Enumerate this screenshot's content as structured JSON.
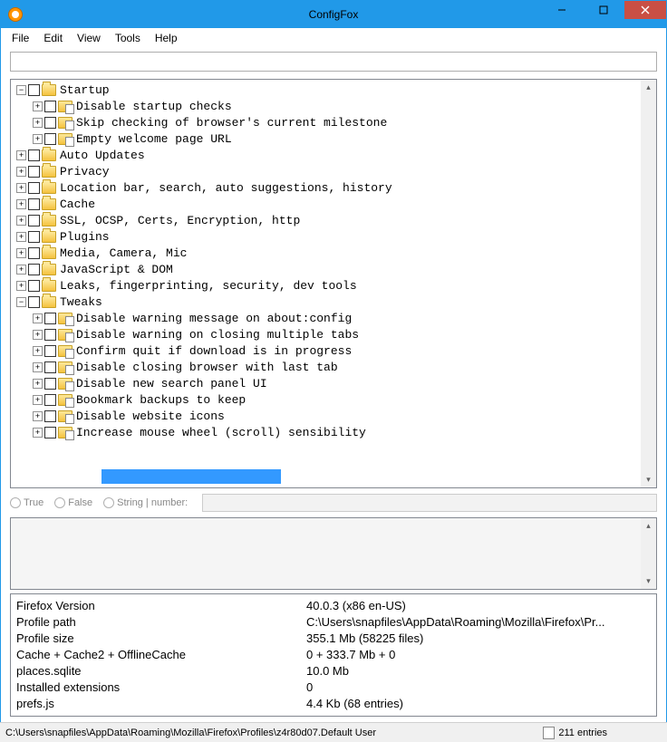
{
  "window": {
    "title": "ConfigFox"
  },
  "menu": [
    "File",
    "Edit",
    "View",
    "Tools",
    "Help"
  ],
  "tree": [
    {
      "indent": 0,
      "exp": "-",
      "check": true,
      "icon": "open",
      "label": "Startup"
    },
    {
      "indent": 1,
      "exp": "+",
      "check": true,
      "icon": "doc",
      "label": "Disable startup checks"
    },
    {
      "indent": 1,
      "exp": "+",
      "check": true,
      "icon": "doc",
      "label": "Skip checking of browser's current milestone"
    },
    {
      "indent": 1,
      "exp": "+",
      "check": true,
      "icon": "doc",
      "label": "Empty welcome page URL"
    },
    {
      "indent": 0,
      "exp": "+",
      "check": true,
      "icon": "open",
      "label": "Auto Updates"
    },
    {
      "indent": 0,
      "exp": "+",
      "check": true,
      "icon": "open",
      "label": "Privacy"
    },
    {
      "indent": 0,
      "exp": "+",
      "check": true,
      "icon": "open",
      "label": "Location bar, search, auto suggestions, history"
    },
    {
      "indent": 0,
      "exp": "+",
      "check": true,
      "icon": "open",
      "label": "Cache"
    },
    {
      "indent": 0,
      "exp": "+",
      "check": true,
      "icon": "open",
      "label": "SSL, OCSP, Certs, Encryption, http"
    },
    {
      "indent": 0,
      "exp": "+",
      "check": true,
      "icon": "open",
      "label": "Plugins"
    },
    {
      "indent": 0,
      "exp": "+",
      "check": true,
      "icon": "open",
      "label": "Media, Camera, Mic"
    },
    {
      "indent": 0,
      "exp": "+",
      "check": true,
      "icon": "open",
      "label": "JavaScript & DOM"
    },
    {
      "indent": 0,
      "exp": "+",
      "check": true,
      "icon": "open",
      "label": "Leaks, fingerprinting, security, dev tools"
    },
    {
      "indent": 0,
      "exp": "-",
      "check": true,
      "icon": "open",
      "label": "Tweaks"
    },
    {
      "indent": 1,
      "exp": "+",
      "check": true,
      "icon": "doc",
      "label": "Disable warning message on about:config"
    },
    {
      "indent": 1,
      "exp": "+",
      "check": true,
      "icon": "doc",
      "label": "Disable warning on closing multiple tabs"
    },
    {
      "indent": 1,
      "exp": "+",
      "check": true,
      "icon": "doc",
      "label": "Confirm quit if download is in progress"
    },
    {
      "indent": 1,
      "exp": "+",
      "check": true,
      "icon": "doc",
      "label": "Disable closing browser with last tab"
    },
    {
      "indent": 1,
      "exp": "+",
      "check": true,
      "icon": "doc",
      "label": "Disable new search panel UI"
    },
    {
      "indent": 1,
      "exp": "+",
      "check": true,
      "icon": "doc",
      "label": "Bookmark backups to keep"
    },
    {
      "indent": 1,
      "exp": "+",
      "check": true,
      "icon": "doc",
      "label": "Disable website icons"
    },
    {
      "indent": 1,
      "exp": "+",
      "check": true,
      "icon": "doc",
      "label": "Increase mouse wheel (scroll) sensibility"
    }
  ],
  "options": {
    "true": "True",
    "false": "False",
    "string": "String | number:"
  },
  "info": [
    {
      "k": "Firefox Version",
      "v": "40.0.3 (x86 en-US)"
    },
    {
      "k": "Profile path",
      "v": "C:\\Users\\snapfiles\\AppData\\Roaming\\Mozilla\\Firefox\\Pr..."
    },
    {
      "k": "Profile size",
      "v": "355.1 Mb (58225 files)"
    },
    {
      "k": "Cache + Cache2 + OfflineCache",
      "v": "0 + 333.7 Mb + 0"
    },
    {
      "k": "places.sqlite",
      "v": "10.0 Mb"
    },
    {
      "k": "Installed extensions",
      "v": "0"
    },
    {
      "k": "prefs.js",
      "v": "4.4 Kb (68 entries)"
    }
  ],
  "status": {
    "path": "C:\\Users\\snapfiles\\AppData\\Roaming\\Mozilla\\Firefox\\Profiles\\z4r80d07.Default User",
    "entries": "211 entries"
  }
}
